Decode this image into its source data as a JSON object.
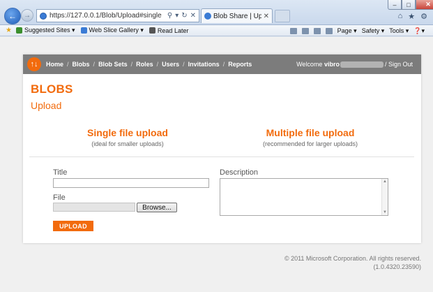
{
  "browser": {
    "url": "https://127.0.0.1/Blob/Upload#single",
    "tab_title": "Blob Share | Upload Blob",
    "favorites": [
      {
        "label": "Suggested Sites ▾",
        "icon": "suggested-sites-icon",
        "color": "#3a8f2e"
      },
      {
        "label": "Web Slice Gallery ▾",
        "icon": "web-slice-icon",
        "color": "#3a7bd5"
      },
      {
        "label": "Read Later",
        "icon": "read-later-icon",
        "color": "#555555"
      }
    ],
    "commands": {
      "page": "Page ▾",
      "safety": "Safety ▾",
      "tools": "Tools ▾",
      "help": "❓▾"
    }
  },
  "app": {
    "logo": "↑↓",
    "nav": [
      "Home",
      "Blobs",
      "Blob Sets",
      "Roles",
      "Users",
      "Invitations",
      "Reports"
    ],
    "welcome_prefix": "Welcome",
    "welcome_user": "vibro",
    "sign_out": "Sign Out",
    "heading": "BLOBS",
    "subheading": "Upload",
    "single_title": "Single file upload",
    "single_sub": "(ideal for smaller uploads)",
    "multi_title": "Multiple file upload",
    "multi_sub": "(recommended for larger uploads)",
    "form": {
      "title_label": "Title",
      "title_value": "",
      "file_label": "File",
      "browse_label": "Browse...",
      "description_label": "Description",
      "description_value": "",
      "upload_button": "UPLOAD"
    },
    "footer_copyright": "© 2011 Microsoft Corporation. All rights reserved.",
    "footer_version": "(1.0.4320.23590)",
    "accent_color": "#f26b0d"
  }
}
